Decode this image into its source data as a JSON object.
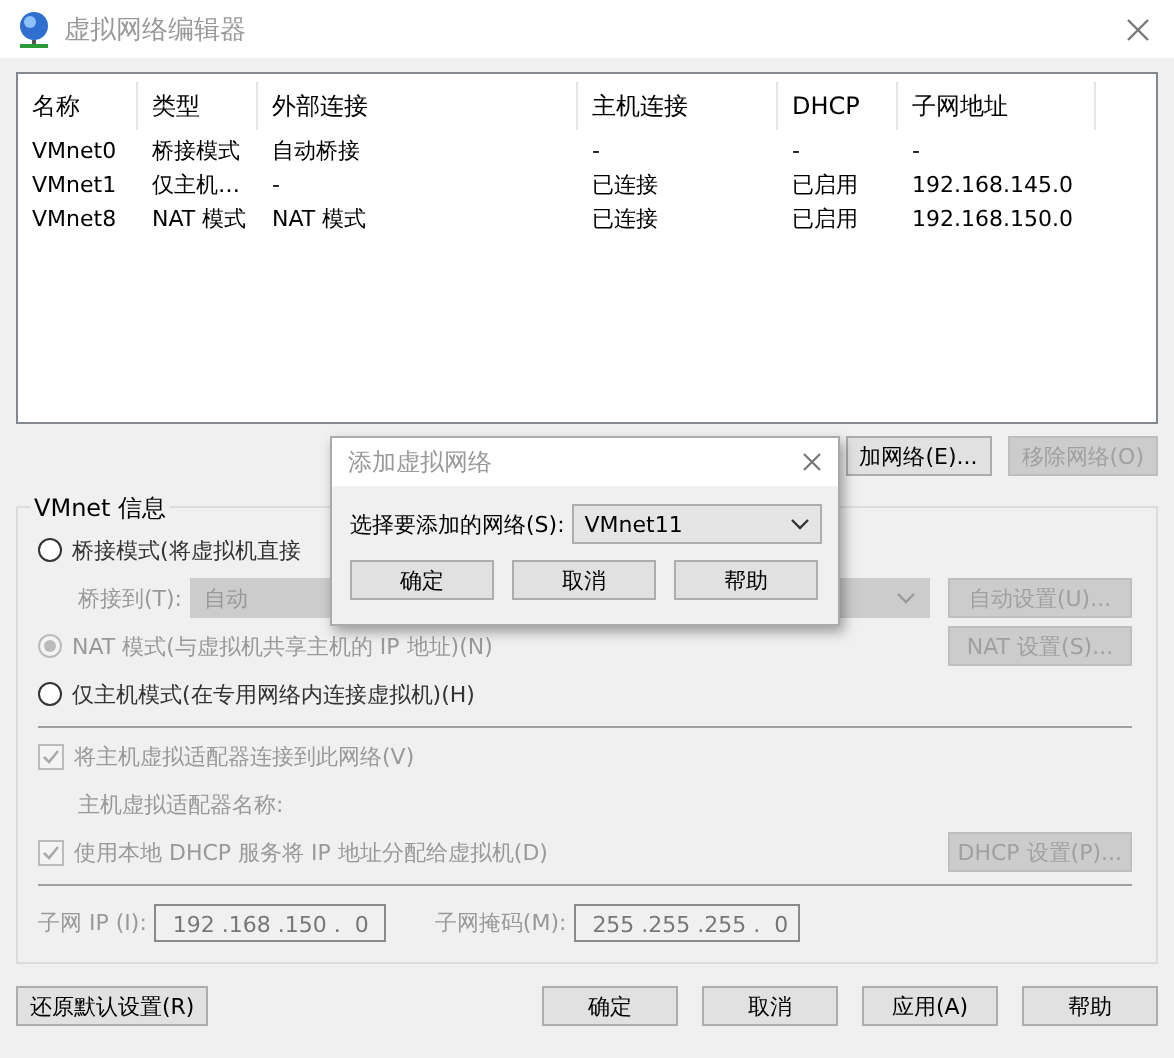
{
  "window": {
    "title": "虚拟网络编辑器"
  },
  "networks": {
    "columns": [
      "名称",
      "类型",
      "外部连接",
      "主机连接",
      "DHCP",
      "子网地址"
    ],
    "rows": [
      {
        "cells": [
          "VMnet0",
          "桥接模式",
          "自动桥接",
          "-",
          "-",
          "-"
        ]
      },
      {
        "cells": [
          "VMnet1",
          "仅主机…",
          "-",
          "已连接",
          "已启用",
          "192.168.145.0"
        ]
      },
      {
        "cells": [
          "VMnet8",
          "NAT 模式",
          "NAT 模式",
          "已连接",
          "已启用",
          "192.168.150.0"
        ]
      }
    ]
  },
  "network_buttons": [
    {
      "label": "加网络(E)...",
      "disabled": false
    },
    {
      "label": "移除网络(O)",
      "disabled": true
    }
  ],
  "vmnet_info": {
    "title": "VMnet 信息",
    "bridge_mode": {
      "label": "桥接模式(将虚拟机直接",
      "selected": false,
      "disabled": false
    },
    "bridge_to": {
      "label": "桥接到(T):",
      "value": "自动",
      "disabled": true
    },
    "auto_settings_button": {
      "label": "自动设置(U)...",
      "disabled": true
    },
    "nat_mode": {
      "label": "NAT 模式(与虚拟机共享主机的 IP 地址)(N)",
      "selected": true,
      "disabled": true
    },
    "nat_settings_button": {
      "label": "NAT 设置(S)...",
      "disabled": true
    },
    "host_only_mode": {
      "label": "仅主机模式(在专用网络内连接虚拟机)(H)",
      "selected": false,
      "disabled": false
    },
    "connect_adapter": {
      "label": "将主机虚拟适配器连接到此网络(V)",
      "checked": true,
      "disabled": true
    },
    "adapter_name": {
      "label": "主机虚拟适配器名称:"
    },
    "use_dhcp": {
      "label": "使用本地 DHCP 服务将 IP 地址分配给虚拟机(D)",
      "checked": true,
      "disabled": true
    },
    "dhcp_settings_button": {
      "label": "DHCP 设置(P)...",
      "disabled": true
    },
    "subnet_ip": {
      "label": "子网 IP (I):",
      "value": "192 .168 .150 .  0"
    },
    "subnet_mask": {
      "label": "子网掩码(M):",
      "value": "255 .255 .255 .  0"
    }
  },
  "restore_button": {
    "label": "还原默认设置(R)"
  },
  "footer_buttons": [
    "确定",
    "取消",
    "应用(A)",
    "帮助"
  ],
  "dialog": {
    "title": "添加虚拟网络",
    "select_label": "选择要添加的网络(S):",
    "select_value": "VMnet11",
    "buttons": [
      "确定",
      "取消",
      "帮助"
    ]
  }
}
